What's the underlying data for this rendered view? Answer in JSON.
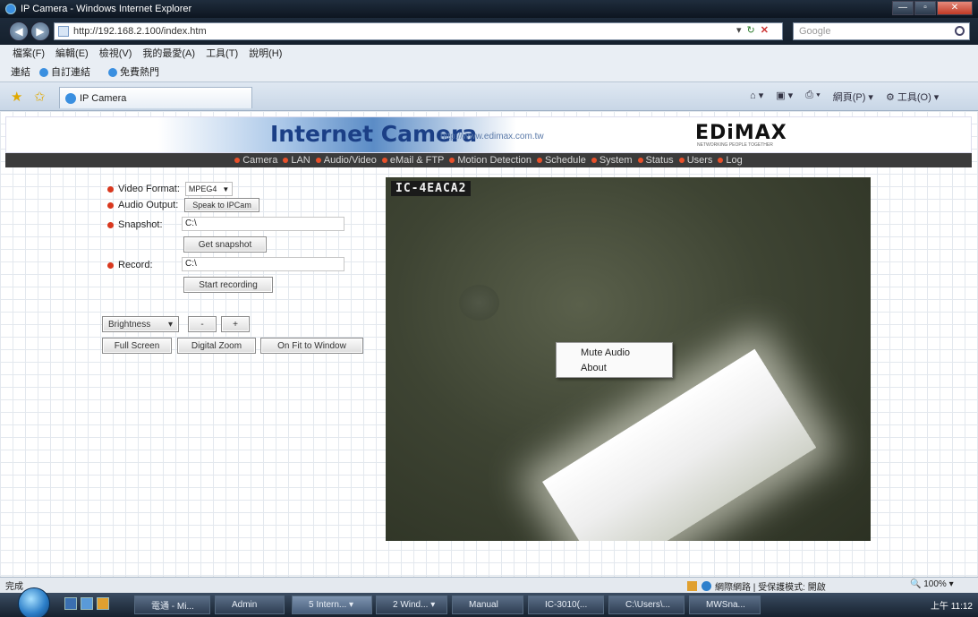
{
  "window": {
    "title": "IP Camera - Windows Internet Explorer",
    "min": "—",
    "max": "▫",
    "close": "✕"
  },
  "address": {
    "url": "http://192.168.2.100/index.htm",
    "search_placeholder": "Google"
  },
  "menubar": {
    "items": [
      "檔案(F)",
      "編輯(E)",
      "檢視(V)",
      "我的最愛(A)",
      "工具(T)",
      "說明(H)"
    ]
  },
  "favbar": {
    "items": [
      "連結",
      "自訂連結",
      "免費熱門"
    ]
  },
  "tab": {
    "label": "IP Camera"
  },
  "cmdbar": {
    "items": [
      "⌂ ▾",
      "▣ ▾",
      "⎙ ▾",
      "網頁(P) ▾",
      "⚙ 工具(O) ▾"
    ]
  },
  "banner": {
    "title": "Internet Camera",
    "url": "http://www.edimax.com.tw",
    "logo": "EDiMAX",
    "tagline": "NETWORKING PEOPLE TOGETHER"
  },
  "nav": [
    "Camera",
    "LAN",
    "Audio/Video",
    "eMail & FTP",
    "Motion Detection",
    "Schedule",
    "System",
    "Status",
    "Users",
    "Log"
  ],
  "controls": {
    "video_format_label": "Video Format:",
    "video_format_value": "MPEG4",
    "audio_output_label": "Audio Output:",
    "speak_button": "Speak to IPCam",
    "snapshot_label": "Snapshot:",
    "snapshot_path": "C:\\",
    "get_snapshot_button": "Get snapshot",
    "record_label": "Record:",
    "record_path": "C:\\",
    "start_recording_button": "Start recording",
    "adjust_select": "Brightness",
    "minus_button": "-",
    "plus_button": "+",
    "full_screen_button": "Full Screen",
    "digital_zoom_button": "Digital Zoom",
    "fit_window_button": "On Fit to Window"
  },
  "video": {
    "camera_label": "IC-4EACA2"
  },
  "context_menu": {
    "items": [
      "Mute Audio",
      "About"
    ]
  },
  "statusbar": {
    "done": "完成",
    "zone": "網際網路 | 受保護模式: 開啟",
    "zoom": "🔍 100%  ▾"
  },
  "taskbar": {
    "tasks": [
      "電通 - Mi...",
      "Admin",
      "5 Intern... ▾",
      "2 Wind... ▾",
      "Manual",
      "IC-3010(...",
      "C:\\Users\\...",
      "MWSna..."
    ],
    "clock": "上午 11:12"
  }
}
